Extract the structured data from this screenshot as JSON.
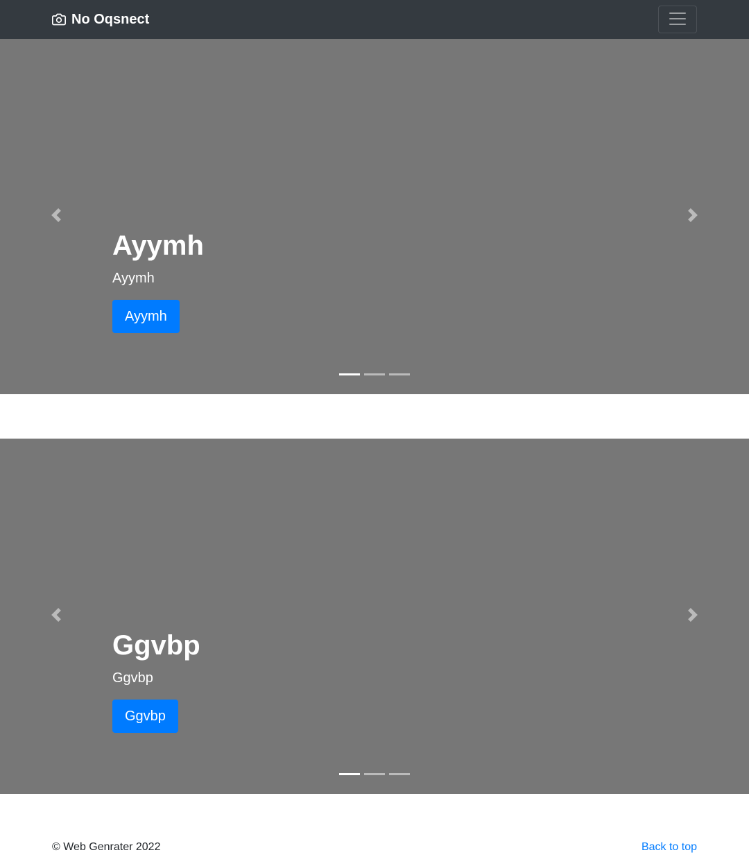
{
  "navbar": {
    "brand": "No Oqsnect",
    "brand_icon": "camera-icon",
    "toggler_icon": "hamburger-menu-icon",
    "background": "#343a40"
  },
  "carousels": [
    {
      "caption_title": "Ayymh",
      "caption_text": "Ayymh",
      "button_label": "Ayymh",
      "prev_icon": "chevron-left-icon",
      "next_icon": "chevron-right-icon",
      "indicator_count": 3,
      "active_indicator": 1
    },
    {
      "caption_title": "Ggvbp",
      "caption_text": "Ggvbp",
      "button_label": "Ggvbp",
      "prev_icon": "chevron-left-icon",
      "next_icon": "chevron-right-icon",
      "indicator_count": 3,
      "active_indicator": 1
    }
  ],
  "footer": {
    "copyright": "© Web Genrater 2022",
    "back_to_top": "Back to top"
  },
  "colors": {
    "primary": "#007bff",
    "slide_background": "#777777"
  }
}
